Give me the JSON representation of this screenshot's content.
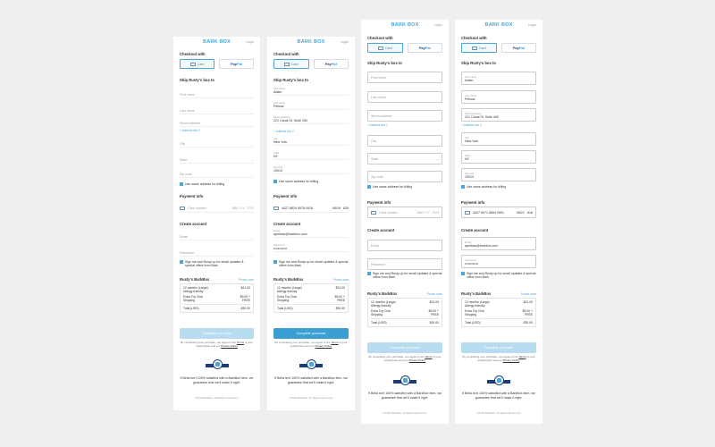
{
  "brand": {
    "logo": "BARK BOX",
    "login": "Login",
    "accent": "#4aa7d9"
  },
  "checkout": {
    "title": "Checkout with",
    "card": "Card",
    "paypal_a": "Pay",
    "paypal_b": "Pal"
  },
  "shipping": {
    "title": "Ship Rusty's box to",
    "first_name": "First name",
    "last_name": "Last name",
    "street": "Street address",
    "add_line": "+ Address line 2",
    "city": "City",
    "state": "State",
    "zip": "Zip code",
    "same_billing": "Use same address for billing"
  },
  "filled": {
    "first_name": "Adam",
    "last_name": "Pelloss",
    "street": "221 Canal St. Suite 400",
    "street_s2": "221 Canal St. Suite 250",
    "city": "New York",
    "state": "NY",
    "zip": "10013"
  },
  "payment": {
    "title": "Payment info",
    "card_number": "Card number",
    "mm_yy": "MM / YY",
    "cvv": "CVV",
    "filled_number": "4427 6071 8894 0591",
    "filled_number_s2": "4427 8829 9576 0918",
    "filled_exp": "05/21",
    "filled_exp_s2": "06/19",
    "filled_cvv": "816",
    "filled_cvv_s2": "830"
  },
  "account": {
    "title": "Create account",
    "email": "Email",
    "password": "Password",
    "filled_email": "apelloss@barkbox.com",
    "filled_email_s2": "apellose@barkbox.com",
    "filled_password": "••••••••••••",
    "signup": "Sign me and Rusty up for email updates & special offers from Bark"
  },
  "summary": {
    "title": "Rusty's BarkBox",
    "promo": "Promo code",
    "item": "12 months (Large) Allergy-friendly",
    "item_price": "$21.00",
    "extra": "Extra Toy Club",
    "extra_price": "$9.00 +",
    "shipping": "Shipping",
    "shipping_price": "FREE",
    "total_label": "Total (USD)",
    "total": "$30.00"
  },
  "cta": {
    "complete": "Complete purchase",
    "terms_a": "By completing your purchase, you agree to the",
    "terms_link": "Terms",
    "terms_b": "of your subscription and our",
    "privacy": "Privacy Policy",
    "guarantee": "If Bella isn't 100% satisfied with a BarkBox item, we guarantee that we'll make it right.",
    "copyright": "©2018 BarkBox. All Rights Reserved."
  }
}
